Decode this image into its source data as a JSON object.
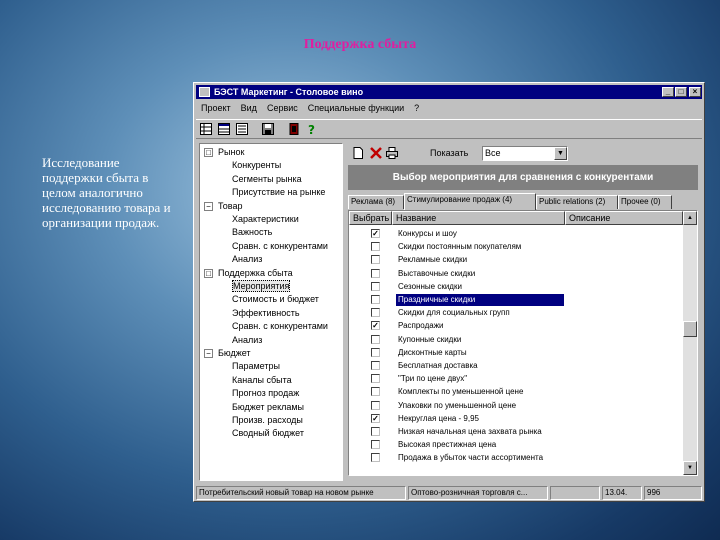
{
  "slide": {
    "title": "Поддержка сбыта",
    "text": "Исследование поддержки сбыта в целом аналогично исследованию товара и организации продаж."
  },
  "window": {
    "title": "БЭСТ Маркетинг - Столовое вино",
    "controls": {
      "minimize": "_",
      "maximize": "□",
      "close": "×"
    }
  },
  "menu": [
    "Проект",
    "Вид",
    "Сервис",
    "Специальные функции",
    "?"
  ],
  "toolbar_icons": [
    "grid-icon",
    "table-icon",
    "list-icon",
    "save-icon",
    "exit-icon",
    "help-icon"
  ],
  "tree": [
    {
      "label": "Рынок",
      "level": 0,
      "expander": "□",
      "selected": false
    },
    {
      "label": "Конкуренты",
      "level": 1,
      "selected": false
    },
    {
      "label": "Сегменты рынка",
      "level": 1,
      "selected": false
    },
    {
      "label": "Присутствие на рынке",
      "level": 1,
      "selected": false
    },
    {
      "label": "Товар",
      "level": 0,
      "expander": "−",
      "selected": false
    },
    {
      "label": "Характеристики",
      "level": 1,
      "selected": false
    },
    {
      "label": "Важность",
      "level": 1,
      "selected": false
    },
    {
      "label": "Сравн. с конкурентами",
      "level": 1,
      "selected": false
    },
    {
      "label": "Анализ",
      "level": 1,
      "selected": false
    },
    {
      "label": "Поддержка сбыта",
      "level": 0,
      "expander": "□",
      "selected": false
    },
    {
      "label": "Мероприятия",
      "level": 1,
      "selected": true
    },
    {
      "label": "Стоимость и бюджет",
      "level": 1,
      "selected": false
    },
    {
      "label": "Эффективность",
      "level": 1,
      "selected": false
    },
    {
      "label": "Сравн. с конкурентами",
      "level": 1,
      "selected": false
    },
    {
      "label": "Анализ",
      "level": 1,
      "selected": false
    },
    {
      "label": "Бюджет",
      "level": 0,
      "expander": "−",
      "selected": false
    },
    {
      "label": "Параметры",
      "level": 1,
      "selected": false
    },
    {
      "label": "Каналы сбыта",
      "level": 1,
      "selected": false
    },
    {
      "label": "Прогноз продаж",
      "level": 1,
      "selected": false
    },
    {
      "label": "Бюджет рекламы",
      "level": 1,
      "selected": false
    },
    {
      "label": "Произв. расходы",
      "level": 1,
      "selected": false
    },
    {
      "label": "Сводный бюджет",
      "level": 1,
      "selected": false
    }
  ],
  "right_toolbar": {
    "icons": [
      "new-doc-icon",
      "delete-icon",
      "print-icon"
    ],
    "show_label": "Показать",
    "show_value": "Все"
  },
  "banner": "Выбор мероприятия для сравнения с конкурентами",
  "tabs": [
    {
      "label": "Реклама (8)",
      "active": false
    },
    {
      "label": "Стимулирование продаж (4)",
      "active": true
    },
    {
      "label": "Public relations (2)",
      "active": false
    },
    {
      "label": "Прочее (0)",
      "active": false
    }
  ],
  "columns": [
    "Выбрать",
    "Название",
    "Описание"
  ],
  "rows": [
    {
      "checked": true,
      "name": "Конкурсы и шоу",
      "selected": false
    },
    {
      "checked": false,
      "name": "Скидки постоянным покупателям",
      "selected": false
    },
    {
      "checked": false,
      "name": "Рекламные скидки",
      "selected": false
    },
    {
      "checked": false,
      "name": "Выставочные скидки",
      "selected": false
    },
    {
      "checked": false,
      "name": "Сезонные скидки",
      "selected": false
    },
    {
      "checked": false,
      "name": "Праздничные скидки",
      "selected": true
    },
    {
      "checked": false,
      "name": "Скидки для социальных групп",
      "selected": false
    },
    {
      "checked": true,
      "name": "Распродажи",
      "selected": false
    },
    {
      "checked": false,
      "name": "Купонные скидки",
      "selected": false
    },
    {
      "checked": false,
      "name": "Дисконтные карты",
      "selected": false
    },
    {
      "checked": false,
      "name": "Бесплатная доставка",
      "selected": false
    },
    {
      "checked": false,
      "name": "\"Три по цене двух\"",
      "selected": false
    },
    {
      "checked": false,
      "name": "Комплекты по уменьшенной цене",
      "selected": false
    },
    {
      "checked": false,
      "name": "Упаковки по уменьшенной цене",
      "selected": false
    },
    {
      "checked": true,
      "name": "Некруглая цена - 9,95",
      "selected": false
    },
    {
      "checked": false,
      "name": "Низкая начальная цена захвата рынка",
      "selected": false
    },
    {
      "checked": false,
      "name": "Высокая престижная цена",
      "selected": false
    },
    {
      "checked": false,
      "name": "Продажа в убыток части ассортимента",
      "selected": false
    }
  ],
  "status": [
    "Потребительский новый товар на новом рынке",
    "Оптово-розничная торговля с...",
    "13.04.",
    "996"
  ]
}
